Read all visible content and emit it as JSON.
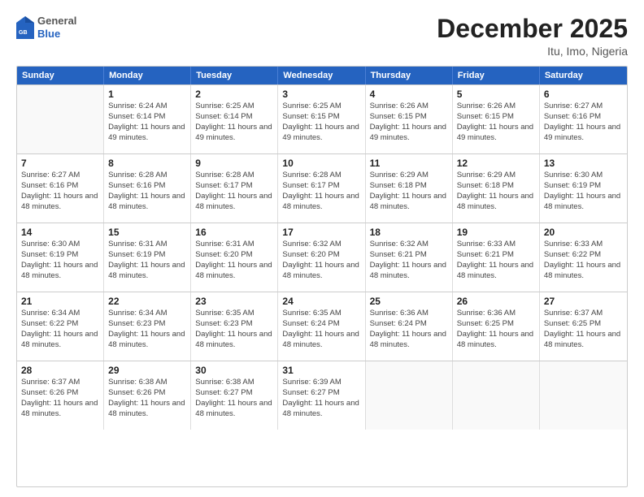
{
  "logo": {
    "general": "General",
    "blue": "Blue"
  },
  "header": {
    "month": "December 2025",
    "location": "Itu, Imo, Nigeria"
  },
  "weekdays": [
    "Sunday",
    "Monday",
    "Tuesday",
    "Wednesday",
    "Thursday",
    "Friday",
    "Saturday"
  ],
  "weeks": [
    [
      {
        "day": "",
        "sunrise": "",
        "sunset": "",
        "daylight": ""
      },
      {
        "day": "1",
        "sunrise": "Sunrise: 6:24 AM",
        "sunset": "Sunset: 6:14 PM",
        "daylight": "Daylight: 11 hours and 49 minutes."
      },
      {
        "day": "2",
        "sunrise": "Sunrise: 6:25 AM",
        "sunset": "Sunset: 6:14 PM",
        "daylight": "Daylight: 11 hours and 49 minutes."
      },
      {
        "day": "3",
        "sunrise": "Sunrise: 6:25 AM",
        "sunset": "Sunset: 6:15 PM",
        "daylight": "Daylight: 11 hours and 49 minutes."
      },
      {
        "day": "4",
        "sunrise": "Sunrise: 6:26 AM",
        "sunset": "Sunset: 6:15 PM",
        "daylight": "Daylight: 11 hours and 49 minutes."
      },
      {
        "day": "5",
        "sunrise": "Sunrise: 6:26 AM",
        "sunset": "Sunset: 6:15 PM",
        "daylight": "Daylight: 11 hours and 49 minutes."
      },
      {
        "day": "6",
        "sunrise": "Sunrise: 6:27 AM",
        "sunset": "Sunset: 6:16 PM",
        "daylight": "Daylight: 11 hours and 49 minutes."
      }
    ],
    [
      {
        "day": "7",
        "sunrise": "Sunrise: 6:27 AM",
        "sunset": "Sunset: 6:16 PM",
        "daylight": "Daylight: 11 hours and 48 minutes."
      },
      {
        "day": "8",
        "sunrise": "Sunrise: 6:28 AM",
        "sunset": "Sunset: 6:16 PM",
        "daylight": "Daylight: 11 hours and 48 minutes."
      },
      {
        "day": "9",
        "sunrise": "Sunrise: 6:28 AM",
        "sunset": "Sunset: 6:17 PM",
        "daylight": "Daylight: 11 hours and 48 minutes."
      },
      {
        "day": "10",
        "sunrise": "Sunrise: 6:28 AM",
        "sunset": "Sunset: 6:17 PM",
        "daylight": "Daylight: 11 hours and 48 minutes."
      },
      {
        "day": "11",
        "sunrise": "Sunrise: 6:29 AM",
        "sunset": "Sunset: 6:18 PM",
        "daylight": "Daylight: 11 hours and 48 minutes."
      },
      {
        "day": "12",
        "sunrise": "Sunrise: 6:29 AM",
        "sunset": "Sunset: 6:18 PM",
        "daylight": "Daylight: 11 hours and 48 minutes."
      },
      {
        "day": "13",
        "sunrise": "Sunrise: 6:30 AM",
        "sunset": "Sunset: 6:19 PM",
        "daylight": "Daylight: 11 hours and 48 minutes."
      }
    ],
    [
      {
        "day": "14",
        "sunrise": "Sunrise: 6:30 AM",
        "sunset": "Sunset: 6:19 PM",
        "daylight": "Daylight: 11 hours and 48 minutes."
      },
      {
        "day": "15",
        "sunrise": "Sunrise: 6:31 AM",
        "sunset": "Sunset: 6:19 PM",
        "daylight": "Daylight: 11 hours and 48 minutes."
      },
      {
        "day": "16",
        "sunrise": "Sunrise: 6:31 AM",
        "sunset": "Sunset: 6:20 PM",
        "daylight": "Daylight: 11 hours and 48 minutes."
      },
      {
        "day": "17",
        "sunrise": "Sunrise: 6:32 AM",
        "sunset": "Sunset: 6:20 PM",
        "daylight": "Daylight: 11 hours and 48 minutes."
      },
      {
        "day": "18",
        "sunrise": "Sunrise: 6:32 AM",
        "sunset": "Sunset: 6:21 PM",
        "daylight": "Daylight: 11 hours and 48 minutes."
      },
      {
        "day": "19",
        "sunrise": "Sunrise: 6:33 AM",
        "sunset": "Sunset: 6:21 PM",
        "daylight": "Daylight: 11 hours and 48 minutes."
      },
      {
        "day": "20",
        "sunrise": "Sunrise: 6:33 AM",
        "sunset": "Sunset: 6:22 PM",
        "daylight": "Daylight: 11 hours and 48 minutes."
      }
    ],
    [
      {
        "day": "21",
        "sunrise": "Sunrise: 6:34 AM",
        "sunset": "Sunset: 6:22 PM",
        "daylight": "Daylight: 11 hours and 48 minutes."
      },
      {
        "day": "22",
        "sunrise": "Sunrise: 6:34 AM",
        "sunset": "Sunset: 6:23 PM",
        "daylight": "Daylight: 11 hours and 48 minutes."
      },
      {
        "day": "23",
        "sunrise": "Sunrise: 6:35 AM",
        "sunset": "Sunset: 6:23 PM",
        "daylight": "Daylight: 11 hours and 48 minutes."
      },
      {
        "day": "24",
        "sunrise": "Sunrise: 6:35 AM",
        "sunset": "Sunset: 6:24 PM",
        "daylight": "Daylight: 11 hours and 48 minutes."
      },
      {
        "day": "25",
        "sunrise": "Sunrise: 6:36 AM",
        "sunset": "Sunset: 6:24 PM",
        "daylight": "Daylight: 11 hours and 48 minutes."
      },
      {
        "day": "26",
        "sunrise": "Sunrise: 6:36 AM",
        "sunset": "Sunset: 6:25 PM",
        "daylight": "Daylight: 11 hours and 48 minutes."
      },
      {
        "day": "27",
        "sunrise": "Sunrise: 6:37 AM",
        "sunset": "Sunset: 6:25 PM",
        "daylight": "Daylight: 11 hours and 48 minutes."
      }
    ],
    [
      {
        "day": "28",
        "sunrise": "Sunrise: 6:37 AM",
        "sunset": "Sunset: 6:26 PM",
        "daylight": "Daylight: 11 hours and 48 minutes."
      },
      {
        "day": "29",
        "sunrise": "Sunrise: 6:38 AM",
        "sunset": "Sunset: 6:26 PM",
        "daylight": "Daylight: 11 hours and 48 minutes."
      },
      {
        "day": "30",
        "sunrise": "Sunrise: 6:38 AM",
        "sunset": "Sunset: 6:27 PM",
        "daylight": "Daylight: 11 hours and 48 minutes."
      },
      {
        "day": "31",
        "sunrise": "Sunrise: 6:39 AM",
        "sunset": "Sunset: 6:27 PM",
        "daylight": "Daylight: 11 hours and 48 minutes."
      },
      {
        "day": "",
        "sunrise": "",
        "sunset": "",
        "daylight": ""
      },
      {
        "day": "",
        "sunrise": "",
        "sunset": "",
        "daylight": ""
      },
      {
        "day": "",
        "sunrise": "",
        "sunset": "",
        "daylight": ""
      }
    ]
  ]
}
